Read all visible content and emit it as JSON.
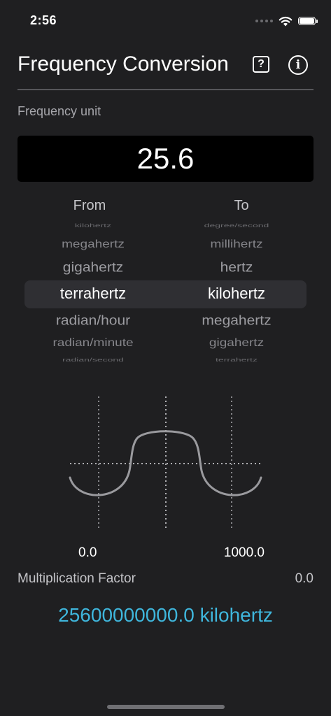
{
  "status_bar": {
    "time": "2:56",
    "icons": [
      "signal-dots-icon",
      "wifi-icon",
      "battery-icon"
    ]
  },
  "nav": {
    "title": "Frequency Conversion",
    "help_glyph": "?",
    "info_glyph": "i"
  },
  "form": {
    "unit_label": "Frequency unit",
    "value": "25.6"
  },
  "picker": {
    "from_header": "From",
    "to_header": "To",
    "from_items": [
      "kilohertz",
      "megahertz",
      "gigahertz",
      "terrahertz",
      "radian/hour",
      "radian/minute",
      "radian/second"
    ],
    "to_items": [
      "degree/second",
      "millihertz",
      "hertz",
      "kilohertz",
      "megahertz",
      "gigahertz",
      "terrahertz"
    ],
    "from_selected": "terrahertz",
    "to_selected": "kilohertz"
  },
  "graph": {
    "range_min": "0.0",
    "range_max": "1000.0"
  },
  "multiplication": {
    "label": "Multiplication Factor",
    "value": "0.0"
  },
  "result": {
    "text": "25600000000.0 kilohertz"
  },
  "colors": {
    "background": "#1f1f21",
    "accent": "#3fb6dc",
    "input_background": "#000000"
  }
}
